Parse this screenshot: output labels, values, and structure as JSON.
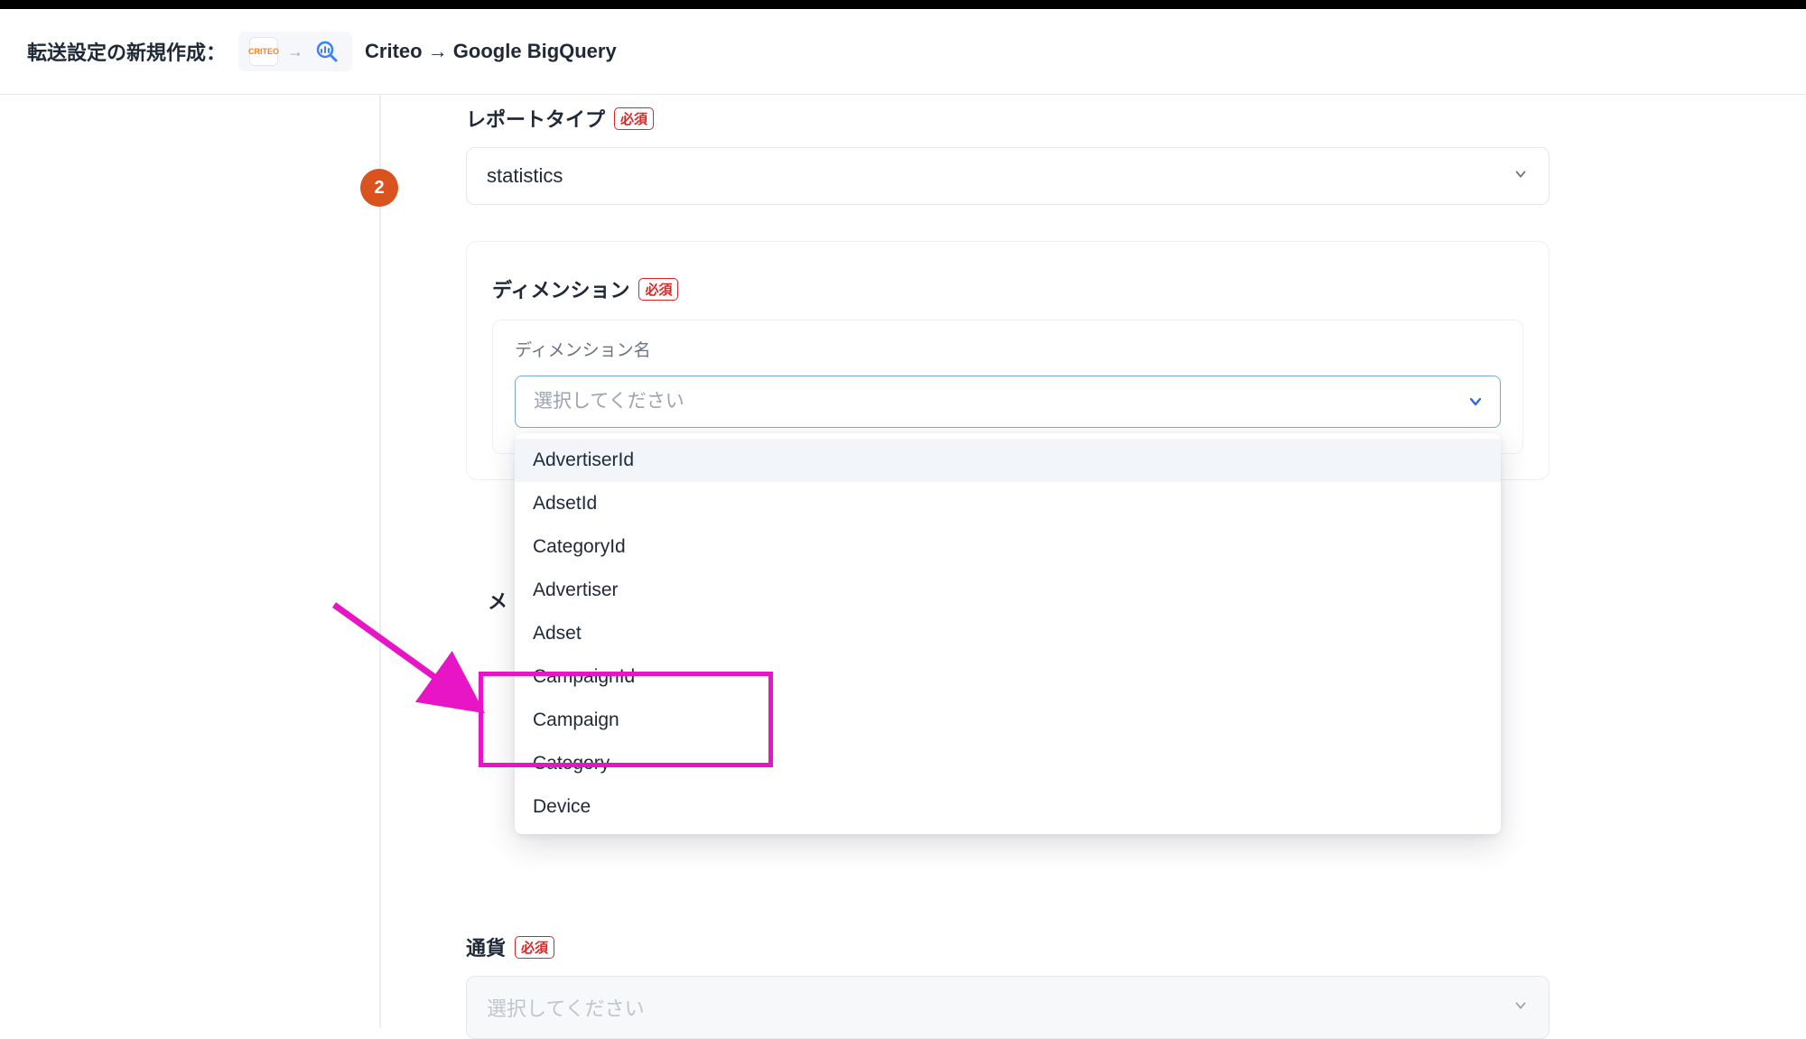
{
  "header": {
    "title_prefix": "転送設定の新規作成：",
    "source_logo_text": "CRITEO",
    "arrow": "→",
    "route": "Criteo → Google BigQuery"
  },
  "step": {
    "number": "2"
  },
  "labels": {
    "report_type": "レポートタイプ",
    "dimension": "ディメンション",
    "dimension_name": "ディメンション名",
    "metric_peek": "メ",
    "currency": "通貨",
    "required": "必須"
  },
  "report_type": {
    "value": "statistics"
  },
  "dimension": {
    "placeholder": "選択してください",
    "options": [
      "AdvertiserId",
      "AdsetId",
      "CategoryId",
      "Advertiser",
      "Adset",
      "CampaignId",
      "Campaign",
      "Category",
      "Device"
    ],
    "highlighted_index": 0
  },
  "currency": {
    "placeholder": "選択してください"
  },
  "annotation": {
    "highlight_items": [
      "CampaignId",
      "Campaign"
    ]
  }
}
